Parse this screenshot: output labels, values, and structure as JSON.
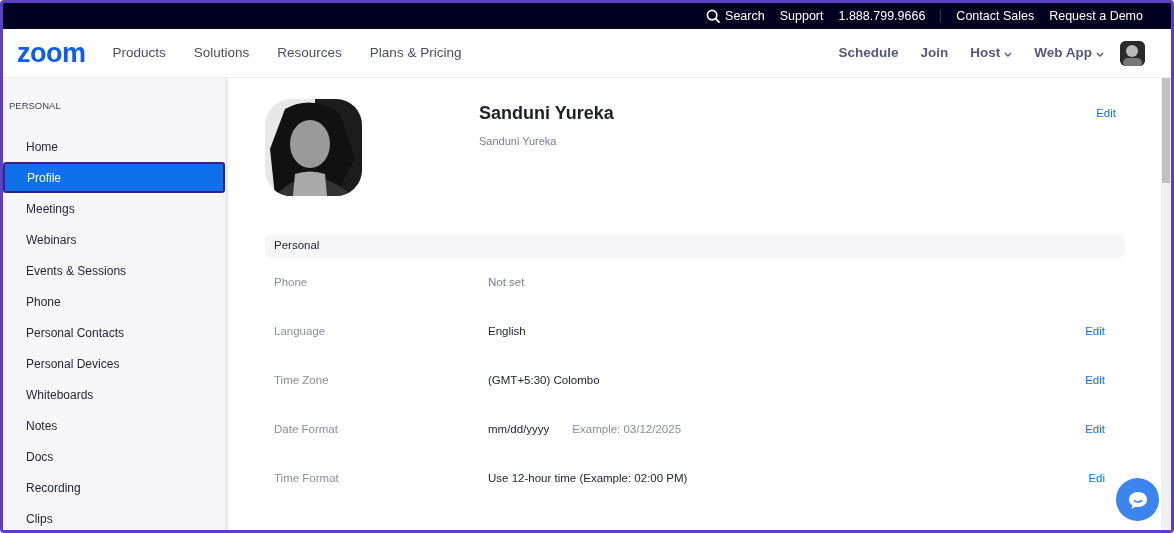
{
  "top_bar": {
    "search": "Search",
    "links": [
      "Support",
      "1.888.799.9666",
      "Contact Sales",
      "Request a Demo"
    ]
  },
  "nav": {
    "logo": "zoom",
    "menu": [
      "Products",
      "Solutions",
      "Resources",
      "Plans & Pricing"
    ],
    "actions": [
      {
        "label": "Schedule",
        "dropdown": false
      },
      {
        "label": "Join",
        "dropdown": false
      },
      {
        "label": "Host",
        "dropdown": true
      },
      {
        "label": "Web App",
        "dropdown": true
      }
    ]
  },
  "sidebar": {
    "heading": "PERSONAL",
    "items": [
      {
        "label": "Home",
        "selected": false
      },
      {
        "label": "Profile",
        "selected": true
      },
      {
        "label": "Meetings",
        "selected": false
      },
      {
        "label": "Webinars",
        "selected": false
      },
      {
        "label": "Events & Sessions",
        "selected": false
      },
      {
        "label": "Phone",
        "selected": false
      },
      {
        "label": "Personal Contacts",
        "selected": false
      },
      {
        "label": "Personal Devices",
        "selected": false
      },
      {
        "label": "Whiteboards",
        "selected": false
      },
      {
        "label": "Notes",
        "selected": false
      },
      {
        "label": "Docs",
        "selected": false
      },
      {
        "label": "Recording",
        "selected": false
      },
      {
        "label": "Clips",
        "selected": false
      }
    ]
  },
  "profile": {
    "name": "Sanduni Yureka",
    "display_name": "Sanduni Yureka",
    "edit": "Edit"
  },
  "section": {
    "title": "Personal",
    "rows": [
      {
        "label": "Phone",
        "value": "Not set",
        "muted": true
      },
      {
        "label": "Language",
        "value": "English",
        "muted": false,
        "edit": "Edit"
      },
      {
        "label": "Time Zone",
        "value": "(GMT+5:30) Colombo",
        "muted": false,
        "edit": "Edit"
      },
      {
        "label": "Date Format",
        "value": "mm/dd/yyyy",
        "muted": false,
        "example": "Example: 03/12/2025",
        "edit": "Edit"
      },
      {
        "label": "Time Format",
        "value": "Use 12-hour time (Example: 02:00 PM)",
        "muted": false,
        "edit": "Edi"
      }
    ]
  }
}
